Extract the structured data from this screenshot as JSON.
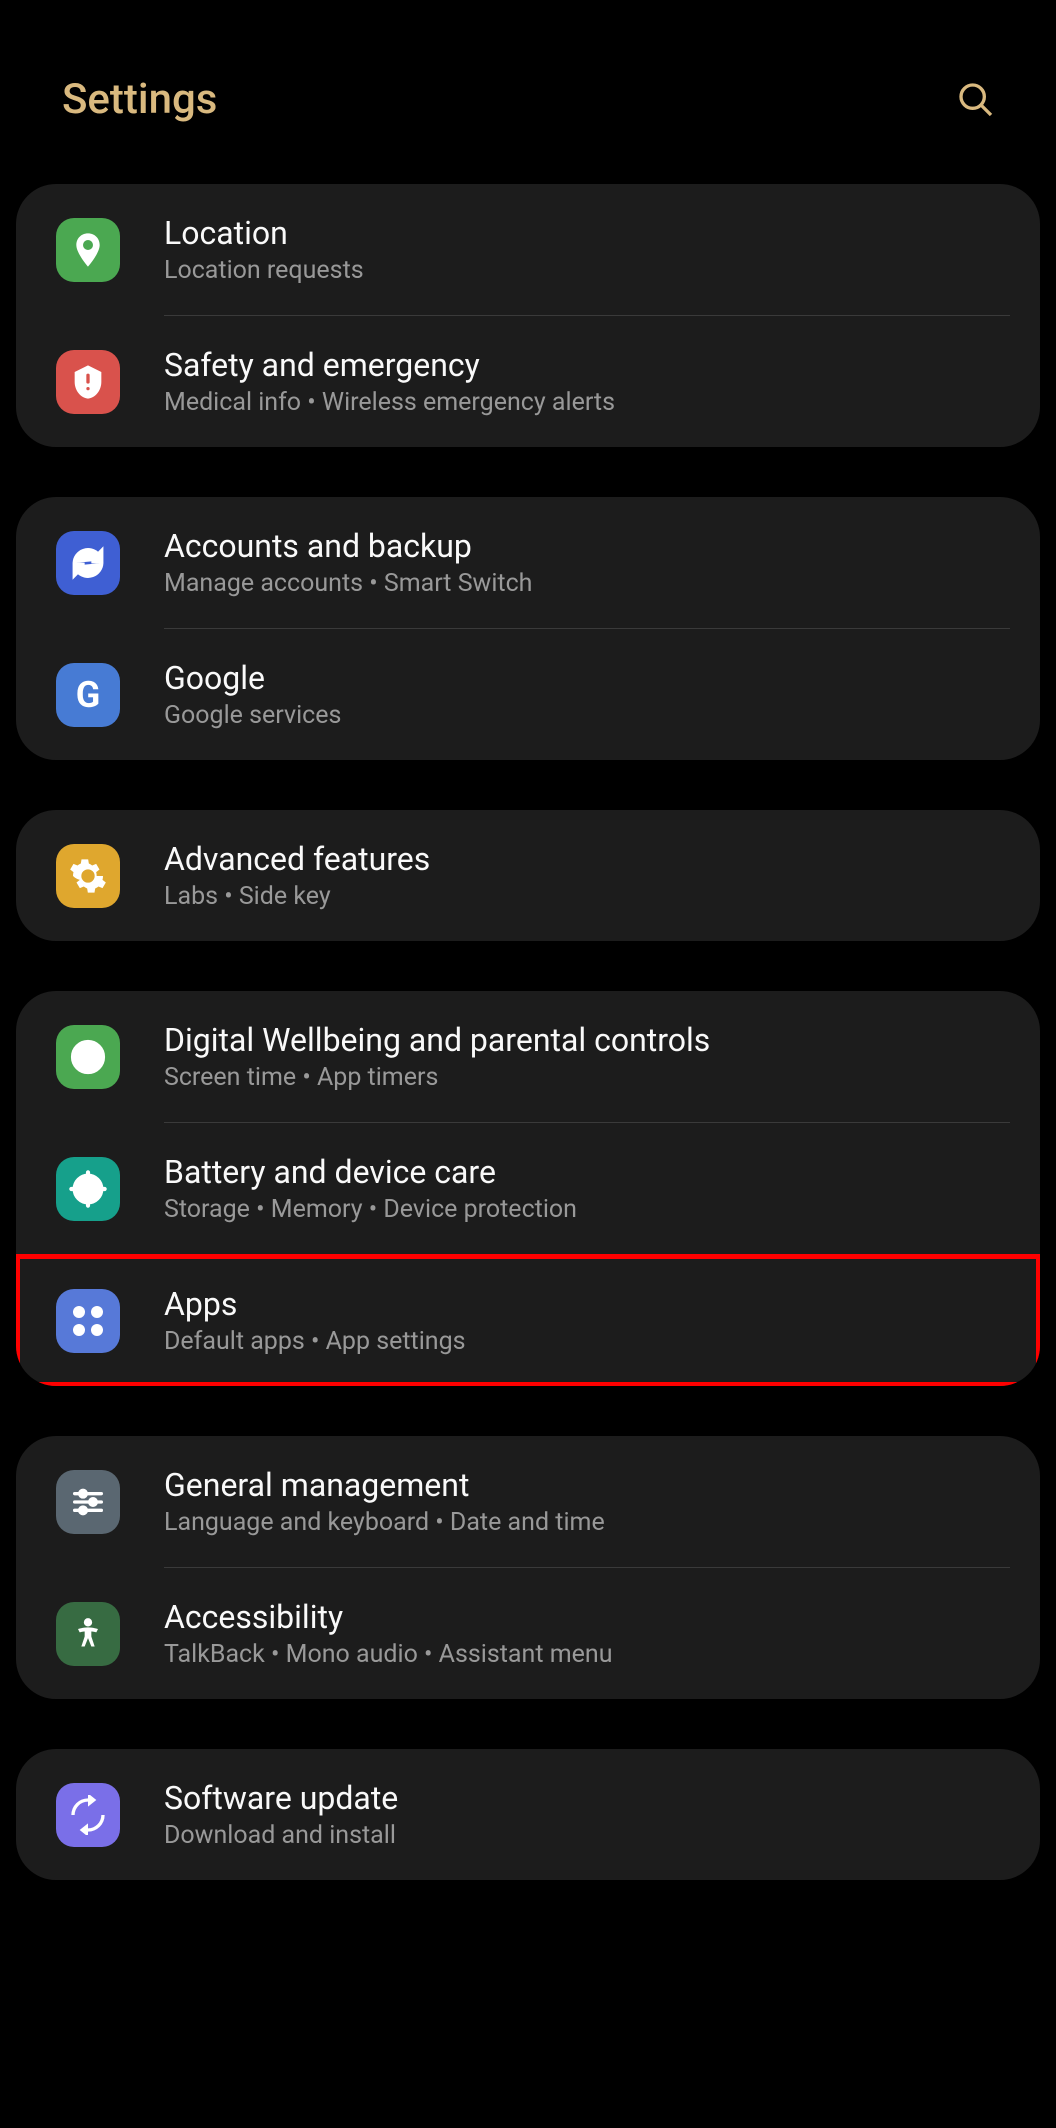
{
  "header": {
    "title": "Settings"
  },
  "groups": [
    {
      "items": [
        {
          "id": "location",
          "title": "Location",
          "subtitle": "Location requests",
          "iconBg": "bg-green",
          "iconType": "location"
        },
        {
          "id": "safety",
          "title": "Safety and emergency",
          "subtitle": "Medical info  •  Wireless emergency alerts",
          "iconBg": "bg-red",
          "iconType": "safety"
        }
      ]
    },
    {
      "items": [
        {
          "id": "accounts",
          "title": "Accounts and backup",
          "subtitle": "Manage accounts  •  Smart Switch",
          "iconBg": "bg-blue",
          "iconType": "sync"
        },
        {
          "id": "google",
          "title": "Google",
          "subtitle": "Google services",
          "iconBg": "bg-blue2",
          "iconType": "google"
        }
      ]
    },
    {
      "items": [
        {
          "id": "advanced",
          "title": "Advanced features",
          "subtitle": "Labs  •  Side key",
          "iconBg": "bg-yellow",
          "iconType": "gear"
        }
      ]
    },
    {
      "items": [
        {
          "id": "wellbeing",
          "title": "Digital Wellbeing and parental controls",
          "subtitle": "Screen time  •  App timers",
          "iconBg": "bg-green",
          "iconType": "wellbeing"
        },
        {
          "id": "battery",
          "title": "Battery and device care",
          "subtitle": "Storage  •  Memory  •  Device protection",
          "iconBg": "bg-teal",
          "iconType": "battery"
        },
        {
          "id": "apps",
          "title": "Apps",
          "subtitle": "Default apps  •  App settings",
          "iconBg": "bg-blue3",
          "iconType": "apps",
          "highlighted": true
        }
      ]
    },
    {
      "items": [
        {
          "id": "general",
          "title": "General management",
          "subtitle": "Language and keyboard  •  Date and time",
          "iconBg": "bg-gray",
          "iconType": "sliders"
        },
        {
          "id": "accessibility",
          "title": "Accessibility",
          "subtitle": "TalkBack  •  Mono audio  •  Assistant menu",
          "iconBg": "bg-green2",
          "iconType": "accessibility"
        }
      ]
    },
    {
      "items": [
        {
          "id": "software",
          "title": "Software update",
          "subtitle": "Download and install",
          "iconBg": "bg-purple",
          "iconType": "software"
        }
      ]
    }
  ]
}
